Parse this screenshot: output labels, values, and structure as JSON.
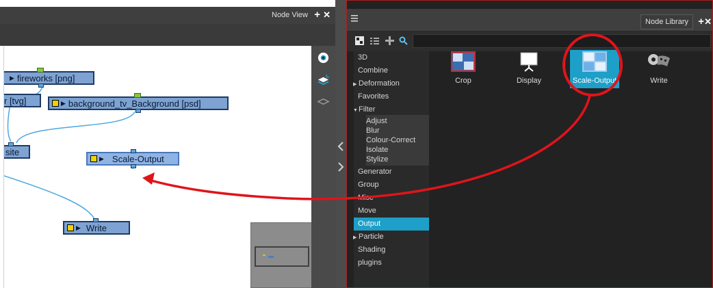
{
  "node_view": {
    "title": "Node View",
    "nodes": {
      "fireworks": {
        "label": "fireworks [png]"
      },
      "tvg": {
        "label": "r [tvg]"
      },
      "background": {
        "label": "background_tv_Background [psd]"
      },
      "composite": {
        "label": "site"
      },
      "scale_output": {
        "label": "Scale-Output"
      },
      "write": {
        "label": "Write"
      }
    }
  },
  "node_library": {
    "title": "Node Library",
    "categories": [
      {
        "label": "3D"
      },
      {
        "label": "Combine"
      },
      {
        "label": "Deformation",
        "expandable": true
      },
      {
        "label": "Favorites"
      },
      {
        "label": "Filter",
        "expanded": true
      },
      {
        "label": "Adjust"
      },
      {
        "label": "Blur"
      },
      {
        "label": "Colour-Correct"
      },
      {
        "label": "Isolate"
      },
      {
        "label": "Stylize"
      },
      {
        "label": "Generator"
      },
      {
        "label": "Group"
      },
      {
        "label": "Misc"
      },
      {
        "label": "Move"
      },
      {
        "label": "Output",
        "selected": true
      },
      {
        "label": "Particle",
        "expandable": true
      },
      {
        "label": "Shading"
      },
      {
        "label": "plugins"
      }
    ],
    "items": [
      {
        "label": "Crop",
        "icon": "crop-icon"
      },
      {
        "label": "Display",
        "icon": "display-icon"
      },
      {
        "label": "Scale-Output",
        "icon": "scale-output-icon",
        "selected": true
      },
      {
        "label": "Write",
        "icon": "film-reel-icon"
      }
    ]
  },
  "colors": {
    "selection": "#1d9fc8",
    "annotation": "#e0141b",
    "node_fill": "#7ea3d2"
  }
}
